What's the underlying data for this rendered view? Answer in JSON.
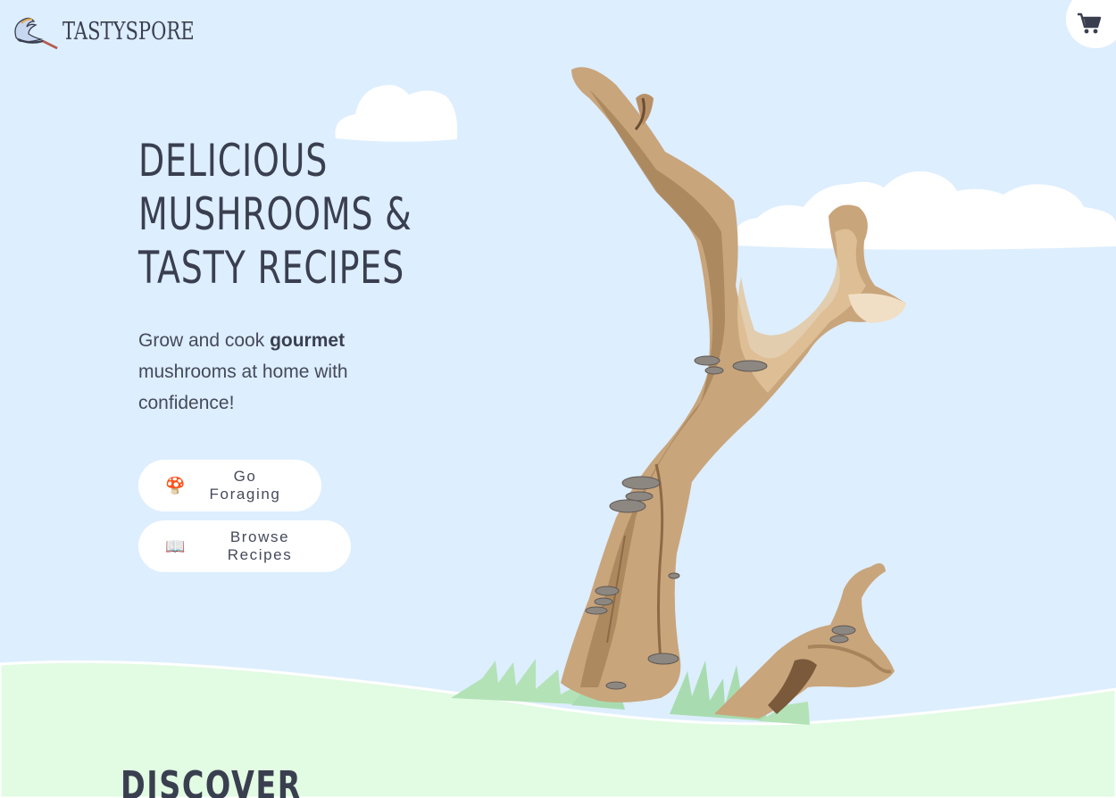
{
  "brand": {
    "name": "TASTYSPORE",
    "logo_icon": "frying-pan-wave-icon"
  },
  "header": {
    "cart_icon": "shopping-cart-icon"
  },
  "hero": {
    "title_lines": [
      "DELICIOUS",
      "MUSHROOMS &",
      "TASTY RECIPES"
    ],
    "subtitle_prefix": "Grow and cook ",
    "subtitle_bold": "gourmet",
    "subtitle_suffix": " mushrooms at home with confidence!"
  },
  "buttons": {
    "forage": {
      "emoji": "🍄",
      "label": "Go Foraging"
    },
    "recipes": {
      "emoji": "📖",
      "label": "Browse Recipes"
    }
  },
  "next_section": {
    "heading": "DISCOVER"
  },
  "colors": {
    "sky": "#ddeefe",
    "grass": "#e2fbe3",
    "text": "#3a3f50",
    "cloud": "#ffffff",
    "wood": "#c9a57c",
    "grass_blades": "#a8dcb0"
  }
}
